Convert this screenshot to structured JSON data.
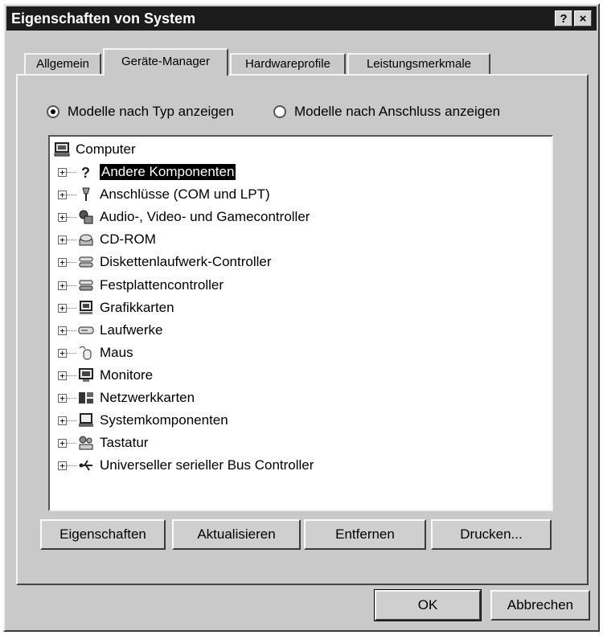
{
  "window": {
    "title": "Eigenschaften von System",
    "help_label": "?",
    "close_label": "×"
  },
  "tabs": [
    {
      "label": "Allgemein",
      "active": false
    },
    {
      "label": "Geräte-Manager",
      "active": true
    },
    {
      "label": "Hardwareprofile",
      "active": false
    },
    {
      "label": "Leistungsmerkmale",
      "active": false
    }
  ],
  "view_options": {
    "by_type": {
      "label": "Modelle nach Typ anzeigen",
      "selected": true
    },
    "by_connection": {
      "label": "Modelle nach Anschluss anzeigen",
      "selected": false
    }
  },
  "tree": {
    "root": {
      "label": "Computer",
      "icon": "computer-icon"
    },
    "items": [
      {
        "label": "Andere Komponenten",
        "icon": "question-mark-icon",
        "selected": true
      },
      {
        "label": "Anschlüsse (COM und LPT)",
        "icon": "port-connector-icon",
        "selected": false
      },
      {
        "label": "Audio-, Video- und Gamecontroller",
        "icon": "audio-video-icon",
        "selected": false
      },
      {
        "label": "CD-ROM",
        "icon": "cdrom-icon",
        "selected": false
      },
      {
        "label": "Diskettenlaufwerk-Controller",
        "icon": "floppy-controller-icon",
        "selected": false
      },
      {
        "label": "Festplattencontroller",
        "icon": "hard-disk-controller-icon",
        "selected": false
      },
      {
        "label": "Grafikkarten",
        "icon": "display-adapter-icon",
        "selected": false
      },
      {
        "label": "Laufwerke",
        "icon": "drive-icon",
        "selected": false
      },
      {
        "label": "Maus",
        "icon": "mouse-icon",
        "selected": false
      },
      {
        "label": "Monitore",
        "icon": "monitor-icon",
        "selected": false
      },
      {
        "label": "Netzwerkkarten",
        "icon": "network-card-icon",
        "selected": false
      },
      {
        "label": "Systemkomponenten",
        "icon": "system-device-icon",
        "selected": false
      },
      {
        "label": "Tastatur",
        "icon": "keyboard-icon",
        "selected": false
      },
      {
        "label": "Universeller serieller Bus Controller",
        "icon": "usb-icon",
        "selected": false
      }
    ]
  },
  "actions": {
    "properties": "Eigenschaften",
    "refresh": "Aktualisieren",
    "remove": "Entfernen",
    "print": "Drucken..."
  },
  "dialog_buttons": {
    "ok": "OK",
    "cancel": "Abbrechen"
  }
}
